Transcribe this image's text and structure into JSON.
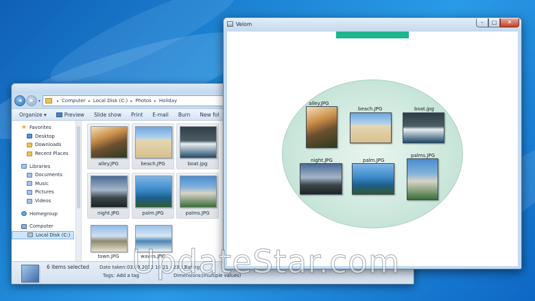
{
  "explorer": {
    "breadcrumb": [
      "Computer",
      "Local Disk (C:)",
      "Photos",
      "Holiday"
    ],
    "toolbar": [
      "Organize ▾",
      "Preview",
      "Slide show",
      "Print",
      "E-mail",
      "Burn",
      "New fol"
    ],
    "nav": {
      "favorites": "Favorites",
      "favorites_items": [
        "Desktop",
        "Downloads",
        "Recent Places"
      ],
      "libraries": "Libraries",
      "libraries_items": [
        "Documents",
        "Music",
        "Pictures",
        "Videos"
      ],
      "homegroup": "Homegroup",
      "computer": "Computer",
      "computer_items": [
        "Local Disk (C:)"
      ]
    },
    "files": [
      "alley.JPG",
      "beach.JPG",
      "boat.jpg",
      "night.JPG",
      "palm.JPG",
      "palms.JPG",
      "town.JPG",
      "waves.JPG"
    ],
    "details": {
      "count": "6 items selected",
      "date_label": "Date taken:",
      "date_value": "03.09.2012 10:21 - 23:11",
      "tags_label": "Tags:",
      "tags_value": "Add a tag",
      "rating_label": "Rating:",
      "dimensions_label": "Dimensions:",
      "dimensions_value": "(multiple values)"
    }
  },
  "velom": {
    "title": "Velom",
    "controls": {
      "minimize": "–",
      "maximize": "□",
      "close": "✕"
    },
    "accent_color": "#1fb58e",
    "photos": [
      "alley.JPG",
      "beach.JPG",
      "boat.jpg",
      "night.JPG",
      "palm.JPG",
      "palms.JPG"
    ]
  },
  "watermark": "UpdateStar.com"
}
